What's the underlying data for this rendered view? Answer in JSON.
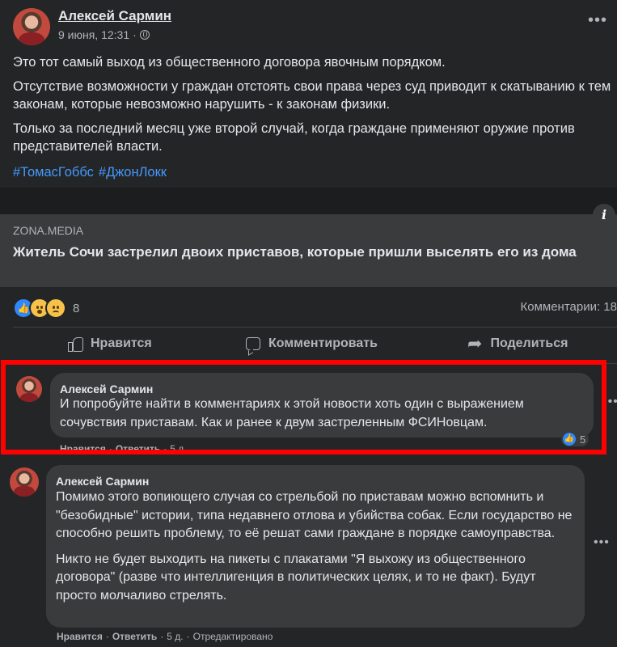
{
  "post": {
    "author": "Алексей Сармин",
    "date": "9 июня, 12:31",
    "separator": "·",
    "paragraphs": [
      "Это тот самый выход из общественного договора явочным порядком.",
      "Отсутствие возможности у граждан отстоять свои права через суд приводит к скатыванию к тем законам, которые невозможно нарушить - к законам физики.",
      "Только за последний месяц уже второй случай, когда граждане применяют оружие против представителей власти."
    ],
    "hashtags": [
      "#ТомасГоббс",
      "#ДжонЛокк"
    ],
    "more_icon": "•••"
  },
  "link": {
    "domain": "ZONA.MEDIA",
    "title": "Житель Сочи застрелил двоих приставов, которые пришли выселять его из дома",
    "info_icon": "i"
  },
  "reactions": {
    "count": "8",
    "types": [
      "like",
      "wow",
      "sad"
    ],
    "comments_label": "Комментарии: 18"
  },
  "actions": {
    "like": "Нравится",
    "comment": "Комментировать",
    "share": "Поделиться"
  },
  "comments": [
    {
      "author": "Алексей Сармин",
      "paragraphs": [
        "И попробуйте найти в комментариях к этой новости хоть один с выражением сочувствия приставам. Как и ранее к двум застреленным ФСИНовцам."
      ],
      "like": "Нравится",
      "reply": "Ответить",
      "time": "5 д.",
      "reactions_count": "5",
      "dot": "·"
    },
    {
      "author": "Алексей Сармин",
      "paragraphs": [
        "Помимо этого вопиющего случая со стрельбой по приставам можно вспомнить и \"безобидные\" истории, типа недавнего отлова и убийства собак. Если государство не способно решить проблему, то её решат сами граждане в порядке самоуправства.",
        "Никто не будет выходить на пикеты с плакатами \"Я выхожу из общественного договора\" (разве что интеллигенция в политических целях, и то не факт). Будут просто молчаливо стрелять."
      ],
      "like": "Нравится",
      "reply": "Ответить",
      "time": "5 д.",
      "edited": "Отредактировано",
      "dot": "·"
    }
  ],
  "colors": {
    "background": "#242526",
    "bubble": "#3a3b3c",
    "hashtag": "#4599ff",
    "highlight": "#ff0000",
    "like_blue": "#2d88ff"
  }
}
